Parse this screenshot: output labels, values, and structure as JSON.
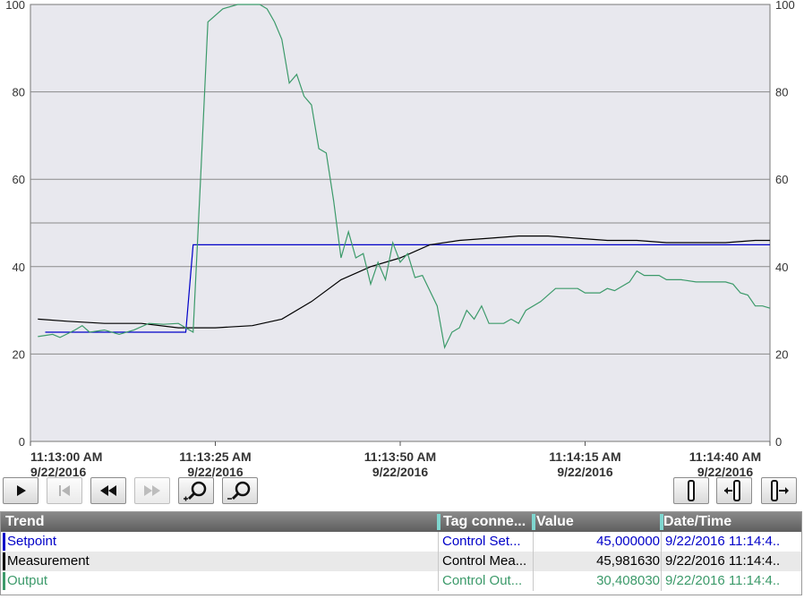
{
  "chart_data": {
    "type": "line",
    "left_axis": {
      "ylim": [
        0,
        100
      ],
      "ticks": [
        "0",
        "20",
        "40",
        "60",
        "80",
        "100"
      ]
    },
    "right_axis": {
      "ylim": [
        0,
        100
      ],
      "ticks": [
        "0",
        "20",
        "40",
        "60",
        "80",
        "100"
      ]
    },
    "x_labels": [
      {
        "time": "11:13:00 AM",
        "date": "9/22/2016"
      },
      {
        "time": "11:13:25 AM",
        "date": "9/22/2016"
      },
      {
        "time": "11:13:50 AM",
        "date": "9/22/2016"
      },
      {
        "time": "11:14:15 AM",
        "date": "9/22/2016"
      },
      {
        "time": "11:14:40 AM",
        "date": "9/22/2016"
      }
    ],
    "x_range_seconds": [
      0,
      100
    ],
    "x_unit_note_seconds_after": "11:13:00 AM",
    "series": [
      {
        "name": "Setpoint",
        "color": "#0000c8",
        "points": [
          [
            2,
            25
          ],
          [
            21,
            25
          ],
          [
            22,
            45
          ],
          [
            100,
            45
          ]
        ]
      },
      {
        "name": "Measurement",
        "color": "#000000",
        "points": [
          [
            1,
            28
          ],
          [
            5,
            27.5
          ],
          [
            10,
            27
          ],
          [
            15,
            27
          ],
          [
            20,
            26
          ],
          [
            25,
            26
          ],
          [
            30,
            26.5
          ],
          [
            34,
            28
          ],
          [
            38,
            32
          ],
          [
            42,
            37
          ],
          [
            46,
            40
          ],
          [
            50,
            42
          ],
          [
            54,
            45
          ],
          [
            58,
            46
          ],
          [
            62,
            46.5
          ],
          [
            66,
            47
          ],
          [
            70,
            47
          ],
          [
            74,
            46.5
          ],
          [
            78,
            46
          ],
          [
            82,
            46
          ],
          [
            86,
            45.5
          ],
          [
            90,
            45.5
          ],
          [
            94,
            45.5
          ],
          [
            98,
            46
          ],
          [
            100,
            46
          ]
        ]
      },
      {
        "name": "Output",
        "color": "#3c9a6a",
        "points": [
          [
            1,
            24
          ],
          [
            3,
            24.5
          ],
          [
            4,
            23.8
          ],
          [
            6,
            25.5
          ],
          [
            7,
            26.5
          ],
          [
            8,
            25
          ],
          [
            10,
            25.5
          ],
          [
            12,
            24.5
          ],
          [
            14,
            25.5
          ],
          [
            16,
            27
          ],
          [
            18,
            26.8
          ],
          [
            20,
            27
          ],
          [
            21,
            26
          ],
          [
            22,
            25
          ],
          [
            23,
            60
          ],
          [
            24,
            96
          ],
          [
            26,
            99
          ],
          [
            28,
            100
          ],
          [
            31,
            100
          ],
          [
            32,
            99
          ],
          [
            33,
            96
          ],
          [
            34,
            92
          ],
          [
            35,
            82
          ],
          [
            36,
            84
          ],
          [
            37,
            79
          ],
          [
            38,
            77
          ],
          [
            39,
            67
          ],
          [
            40,
            66
          ],
          [
            41,
            55
          ],
          [
            42,
            42
          ],
          [
            43,
            48
          ],
          [
            44,
            42
          ],
          [
            45,
            43
          ],
          [
            46,
            36
          ],
          [
            47,
            41
          ],
          [
            48,
            37
          ],
          [
            49,
            45.5
          ],
          [
            50,
            41
          ],
          [
            51,
            43
          ],
          [
            52,
            37.5
          ],
          [
            53,
            38
          ],
          [
            55,
            31
          ],
          [
            56,
            21.5
          ],
          [
            57,
            25
          ],
          [
            58,
            26
          ],
          [
            59,
            30
          ],
          [
            60,
            28
          ],
          [
            61,
            31
          ],
          [
            62,
            27
          ],
          [
            64,
            27
          ],
          [
            65,
            28
          ],
          [
            66,
            27
          ],
          [
            67,
            30
          ],
          [
            69,
            32
          ],
          [
            71,
            35
          ],
          [
            74,
            35
          ],
          [
            75,
            34
          ],
          [
            77,
            34
          ],
          [
            78,
            35
          ],
          [
            79,
            34.5
          ],
          [
            81,
            36.5
          ],
          [
            82,
            39
          ],
          [
            83,
            38
          ],
          [
            85,
            38
          ],
          [
            86,
            37
          ],
          [
            88,
            37
          ],
          [
            90,
            36.5
          ],
          [
            94,
            36.5
          ],
          [
            95,
            36
          ],
          [
            96,
            34
          ],
          [
            97,
            33.5
          ],
          [
            98,
            31
          ],
          [
            99,
            31
          ],
          [
            100,
            30.5
          ]
        ]
      }
    ],
    "limit_line": 50,
    "grid": true
  },
  "toolbar": {
    "left_buttons": [
      "play-icon",
      "first-record-icon",
      "rewind-icon",
      "forward-icon",
      "zoom-in-icon",
      "zoom-out-icon"
    ],
    "right_buttons": [
      "ruler-icon",
      "ruler-left-icon",
      "ruler-right-icon"
    ]
  },
  "table": {
    "headers": {
      "trend": "Trend",
      "tag": "Tag conne...",
      "value": "Value",
      "datetime": "Date/Time"
    },
    "rows": [
      {
        "trend": "Setpoint",
        "tag": "Control Set...",
        "value": "45,000000",
        "datetime": "9/22/2016 11:14:4..",
        "color": "#0000c8"
      },
      {
        "trend": "Measurement",
        "tag": "Control Mea...",
        "value": "45,981630",
        "datetime": "9/22/2016 11:14:4..",
        "color": "#000000"
      },
      {
        "trend": "Output",
        "tag": "Control Out...",
        "value": "30,408030",
        "datetime": "9/22/2016 11:14:4..",
        "color": "#3c9a6a"
      }
    ]
  }
}
